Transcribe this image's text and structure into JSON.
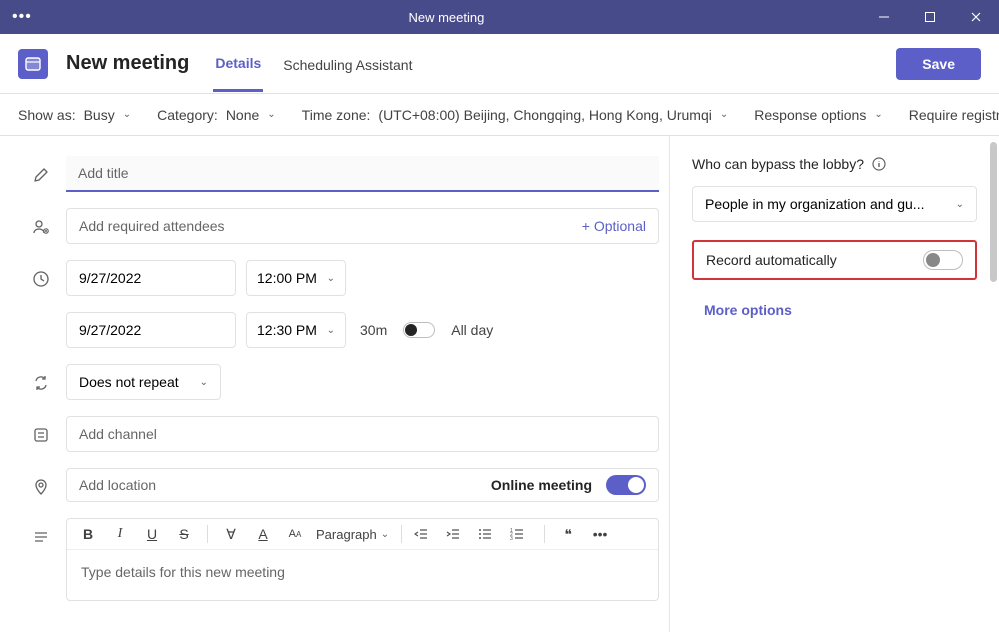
{
  "window": {
    "title": "New meeting"
  },
  "header": {
    "page_title": "New meeting",
    "tabs": {
      "details": "Details",
      "scheduling": "Scheduling Assistant"
    },
    "save": "Save"
  },
  "options_strip": {
    "show_as_label": "Show as:",
    "show_as_value": "Busy",
    "category_label": "Category:",
    "category_value": "None",
    "timezone_label": "Time zone:",
    "timezone_value": "(UTC+08:00) Beijing, Chongqing, Hong Kong, Urumqi",
    "response_options": "Response options",
    "require_registration": "Require registration: N"
  },
  "form": {
    "title_placeholder": "Add title",
    "attendees_placeholder": "Add required attendees",
    "optional_link": "+ Optional",
    "start_date": "9/27/2022",
    "start_time": "12:00 PM",
    "end_date": "9/27/2022",
    "end_time": "12:30 PM",
    "duration": "30m",
    "all_day": "All day",
    "repeat": "Does not repeat",
    "channel_placeholder": "Add channel",
    "location_placeholder": "Add location",
    "online_meeting_label": "Online meeting",
    "editor": {
      "paragraph": "Paragraph",
      "placeholder": "Type details for this new meeting"
    }
  },
  "right_panel": {
    "lobby_label": "Who can bypass the lobby?",
    "lobby_value": "People in my organization and gu...",
    "record_label": "Record automatically",
    "more_options": "More options"
  }
}
